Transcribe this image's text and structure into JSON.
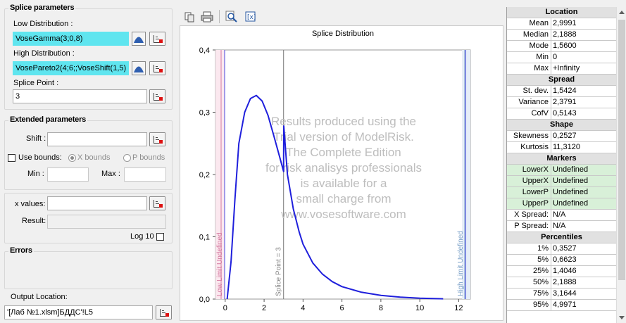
{
  "splice": {
    "title": "Splice parameters",
    "low_label": "Low Distribution :",
    "low_value": "VoseGamma(3;0,8)",
    "high_label": "High Distribution :",
    "high_value": "VosePareto2(4;6;;VoseShift(1,5)",
    "point_label": "Splice Point :",
    "point_value": "3"
  },
  "extended": {
    "title": "Extended parameters",
    "shift_label": "Shift :",
    "shift_value": "",
    "use_bounds_label": "Use bounds:",
    "x_bounds_label": "X bounds",
    "p_bounds_label": "P bounds",
    "min_label": "Min :",
    "max_label": "Max :"
  },
  "xvalues": {
    "label": "x values:",
    "value": "",
    "result_label": "Result:",
    "log_label": "Log 10"
  },
  "errors": {
    "title": "Errors"
  },
  "output": {
    "label": "Output Location:",
    "value": "'[Лаб №1.xlsm]БДДС'!L5"
  },
  "toolbar": {
    "icons": [
      "copy-icon",
      "print-icon",
      "zoom-icon",
      "formula-icon"
    ]
  },
  "watermark": [
    "Results produced using the",
    "Trial version of  ModelRisk.",
    "The Complete Edition",
    "for risk analisys professionals",
    "is available for a",
    "small charge from",
    "www.vosesoftware.com"
  ],
  "chart_data": {
    "type": "line",
    "title": "Splice Distribution",
    "xlim": [
      -0.5,
      12.6
    ],
    "ylim": [
      0,
      0.4
    ],
    "xticks": [
      0,
      2,
      4,
      6,
      8,
      10,
      12
    ],
    "yticks": [
      0,
      0.1,
      0.2,
      0.3,
      0.4
    ],
    "ytick_labels": [
      "0,0",
      "0,1",
      "0,2",
      "0,3",
      "0,4"
    ],
    "series": [
      {
        "color": "#1f1fdc",
        "x": [
          0.1,
          0.3,
          0.5,
          0.7,
          1.0,
          1.3,
          1.6,
          1.9,
          2.2,
          2.5,
          2.8,
          3.0,
          3.01,
          3.2,
          3.5,
          3.8,
          4.0,
          4.5,
          5.0,
          5.5,
          6.0,
          7.0,
          8.0,
          9.0,
          10.0,
          11.2
        ],
        "y": [
          0.0,
          0.06,
          0.16,
          0.25,
          0.3,
          0.322,
          0.327,
          0.318,
          0.295,
          0.262,
          0.228,
          0.205,
          0.278,
          0.2,
          0.145,
          0.108,
          0.088,
          0.058,
          0.04,
          0.028,
          0.02,
          0.011,
          0.006,
          0.003,
          0.0015,
          0.0005
        ]
      }
    ],
    "markers": [
      {
        "x": -0.03,
        "label": "Low Limit Undefined",
        "color": "#d47aa0"
      },
      {
        "x": 3.0,
        "label": "Splice Point = 3",
        "color": "#888888"
      },
      {
        "x": 12.35,
        "label": "High Limit Undefined",
        "color": "#7aa0c8"
      }
    ]
  },
  "stats": [
    {
      "header": "Location"
    },
    {
      "k": "Mean",
      "v": "2,9991"
    },
    {
      "k": "Median",
      "v": "2,1888"
    },
    {
      "k": "Mode",
      "v": "1,5600"
    },
    {
      "k": "Min",
      "v": "0"
    },
    {
      "k": "Max",
      "v": "+Infinity"
    },
    {
      "header": "Spread"
    },
    {
      "k": "St. dev.",
      "v": "1,5424"
    },
    {
      "k": "Variance",
      "v": "2,3791"
    },
    {
      "k": "CofV",
      "v": "0,5143"
    },
    {
      "header": "Shape"
    },
    {
      "k": "Skewness",
      "v": "0,2527"
    },
    {
      "k": "Kurtosis",
      "v": "11,3120"
    },
    {
      "header": "Markers"
    },
    {
      "k": "LowerX",
      "v": "Undefined",
      "green": true
    },
    {
      "k": "UpperX",
      "v": "Undefined",
      "green": true
    },
    {
      "k": "LowerP",
      "v": "Undefined",
      "green": true
    },
    {
      "k": "UpperP",
      "v": "Undefined",
      "green": true
    },
    {
      "k": "X Spread:",
      "v": "N/A"
    },
    {
      "k": "P Spread:",
      "v": "N/A"
    },
    {
      "header": "Percentiles"
    },
    {
      "k": "1%",
      "v": "0,3527"
    },
    {
      "k": "5%",
      "v": "0,6623"
    },
    {
      "k": "25%",
      "v": "1,4046"
    },
    {
      "k": "50%",
      "v": "2,1888"
    },
    {
      "k": "75%",
      "v": "3,1644"
    },
    {
      "k": "95%",
      "v": "4,9971"
    }
  ]
}
